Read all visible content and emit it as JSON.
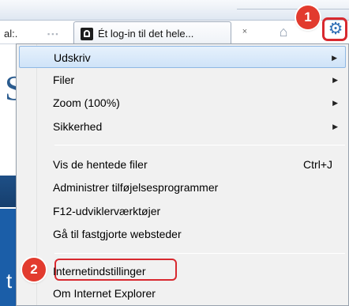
{
  "browser": {
    "address_fragment": "al:.",
    "tab_title": "Ét log-in til det hele...",
    "tab_close_glyph": "×",
    "home_glyph": "⌂",
    "gear_glyph": "⚙"
  },
  "callouts": {
    "step1": "1",
    "step2": "2",
    "accent_color": "#e23b2e"
  },
  "page_behind": {
    "letter": "S",
    "bottom_letter": "t"
  },
  "menu": {
    "groups": [
      [
        {
          "label": "Udskriv",
          "submenu": true,
          "selected": true
        },
        {
          "label": "Filer",
          "submenu": true
        },
        {
          "label": "Zoom (100%)",
          "submenu": true
        },
        {
          "label": "Sikkerhed",
          "submenu": true
        }
      ],
      [
        {
          "label": "Vis de hentede filer",
          "shortcut": "Ctrl+J"
        },
        {
          "label": "Administrer tilføjelsesprogrammer"
        },
        {
          "label": "F12-udviklerværktøjer"
        },
        {
          "label": "Gå til fastgjorte websteder"
        }
      ],
      [
        {
          "label": "Internetindstillinger",
          "highlighted": true
        },
        {
          "label": "Om Internet Explorer"
        }
      ]
    ],
    "arrow_glyph": "▶",
    "selection_color": "#cfe3f8"
  }
}
